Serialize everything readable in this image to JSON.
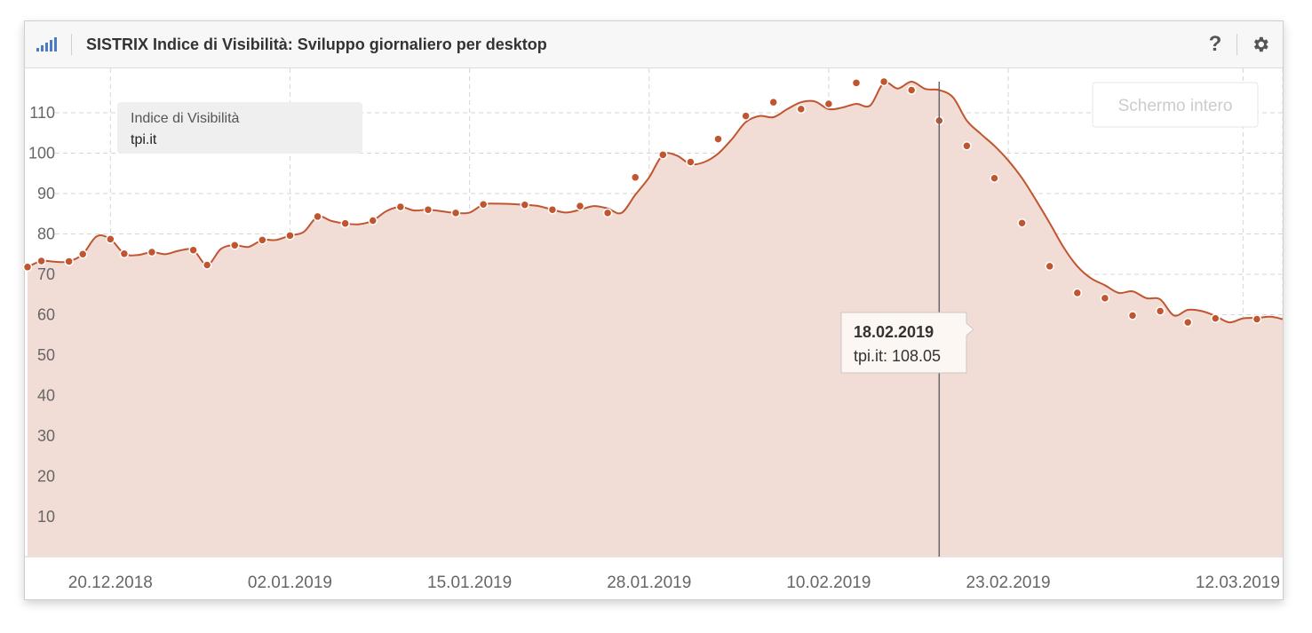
{
  "header": {
    "title": "SISTRIX Indice di Visibilità: Sviluppo giornaliero per desktop",
    "icon": "signal-bars-icon",
    "help_label": "?",
    "settings_icon": "gear-icon"
  },
  "fullscreen_button": {
    "label": "Schermo intero"
  },
  "legend": {
    "title": "Indice di Visibilità",
    "series": "tpi.it"
  },
  "tooltip": {
    "date": "18.02.2019",
    "text": "tpi.it: 108.05"
  },
  "colors": {
    "line": "#c0552f",
    "fill": "#f2ddd6",
    "marker": "#c0552f",
    "grid": "#d6d6d6",
    "crosshair": "#666666"
  },
  "chart_data": {
    "type": "area",
    "title": "SISTRIX Indice di Visibilità: Sviluppo giornaliero per desktop",
    "xlabel": "",
    "ylabel": "",
    "ylim": [
      0,
      120
    ],
    "yticks": [
      10,
      20,
      30,
      40,
      50,
      60,
      70,
      80,
      90,
      100,
      110
    ],
    "xticks": [
      "20.12.2018",
      "02.01.2019",
      "15.01.2019",
      "28.01.2019",
      "10.02.2019",
      "23.02.2019",
      "12.03.2019"
    ],
    "grid": true,
    "legend_position": "top-left",
    "series": [
      {
        "name": "tpi.it",
        "points": [
          [
            "14.12.2018",
            71.8
          ],
          [
            "15.12.2018",
            73.3
          ],
          [
            "16.12.2018",
            73.1
          ],
          [
            "17.12.2018",
            73.2
          ],
          [
            "18.12.2018",
            75.0
          ],
          [
            "19.12.2018",
            79.4
          ],
          [
            "20.12.2018",
            78.7
          ],
          [
            "21.12.2018",
            75.1
          ],
          [
            "22.12.2018",
            74.8
          ],
          [
            "23.12.2018",
            75.5
          ],
          [
            "24.12.2018",
            75.0
          ],
          [
            "25.12.2018",
            75.9
          ],
          [
            "26.12.2018",
            76.0
          ],
          [
            "27.12.2018",
            72.3
          ],
          [
            "28.12.2018",
            76.3
          ],
          [
            "29.12.2018",
            77.2
          ],
          [
            "30.12.2018",
            76.8
          ],
          [
            "31.12.2018",
            78.5
          ],
          [
            "01.01.2019",
            78.5
          ],
          [
            "02.01.2019",
            79.6
          ],
          [
            "03.01.2019",
            80.5
          ],
          [
            "04.01.2019",
            84.3
          ],
          [
            "05.01.2019",
            83.2
          ],
          [
            "06.01.2019",
            82.6
          ],
          [
            "07.01.2019",
            82.4
          ],
          [
            "08.01.2019",
            83.3
          ],
          [
            "09.01.2019",
            85.7
          ],
          [
            "10.01.2019",
            86.7
          ],
          [
            "11.01.2019",
            85.8
          ],
          [
            "12.01.2019",
            86.0
          ],
          [
            "13.01.2019",
            85.6
          ],
          [
            "14.01.2019",
            85.2
          ],
          [
            "15.01.2019",
            85.3
          ],
          [
            "16.01.2019",
            87.3
          ],
          [
            "17.01.2019",
            87.5
          ],
          [
            "18.01.2019",
            87.4
          ],
          [
            "19.01.2019",
            87.2
          ],
          [
            "20.01.2019",
            86.9
          ],
          [
            "21.01.2019",
            86.0
          ],
          [
            "22.01.2019",
            85.3
          ],
          [
            "23.01.2019",
            86.0
          ],
          [
            "24.01.2019",
            86.9
          ],
          [
            "25.01.2019",
            86.3
          ],
          [
            "26.01.2019",
            85.2
          ],
          [
            "27.01.2019",
            89.7
          ],
          [
            "28.01.2019",
            94.0
          ],
          [
            "29.01.2019",
            99.6
          ],
          [
            "30.01.2019",
            99.4
          ],
          [
            "31.01.2019",
            97.3
          ],
          [
            "01.02.2019",
            97.8
          ],
          [
            "02.02.2019",
            99.9
          ],
          [
            "03.02.2019",
            103.5
          ],
          [
            "04.02.2019",
            107.7
          ],
          [
            "05.02.2019",
            109.2
          ],
          [
            "06.02.2019",
            108.9
          ],
          [
            "07.02.2019",
            110.9
          ],
          [
            "08.02.2019",
            112.6
          ],
          [
            "09.02.2019",
            112.8
          ],
          [
            "10.02.2019",
            110.9
          ],
          [
            "11.02.2019",
            111.3
          ],
          [
            "12.02.2019",
            112.2
          ],
          [
            "13.02.2019",
            111.8
          ],
          [
            "14.02.2019",
            117.4
          ],
          [
            "15.02.2019",
            116.0
          ],
          [
            "16.02.2019",
            117.7
          ],
          [
            "17.02.2019",
            115.9
          ],
          [
            "18.02.2019",
            115.6
          ],
          [
            "19.02.2019",
            113.8
          ],
          [
            "20.02.2019",
            108.05
          ],
          [
            "21.02.2019",
            104.8
          ],
          [
            "22.02.2019",
            101.8
          ],
          [
            "23.02.2019",
            98.2
          ],
          [
            "24.02.2019",
            93.8
          ],
          [
            "25.02.2019",
            88.4
          ],
          [
            "26.02.2019",
            82.7
          ],
          [
            "27.02.2019",
            76.7
          ],
          [
            "28.02.2019",
            72.0
          ],
          [
            "01.03.2019",
            69.0
          ],
          [
            "02.03.2019",
            67.3
          ],
          [
            "03.03.2019",
            65.4
          ],
          [
            "04.03.2019",
            65.8
          ],
          [
            "05.03.2019",
            64.1
          ],
          [
            "06.03.2019",
            63.8
          ],
          [
            "07.03.2019",
            59.8
          ],
          [
            "08.03.2019",
            61.2
          ],
          [
            "09.03.2019",
            60.9
          ],
          [
            "10.03.2019",
            59.7
          ],
          [
            "11.03.2019",
            58.1
          ],
          [
            "12.03.2019",
            59.1
          ],
          [
            "13.03.2019",
            59.2
          ],
          [
            "14.03.2019",
            59.5
          ],
          [
            "15.03.2019",
            58.9
          ]
        ],
        "markers": [
          [
            "14.12.2018",
            71.8
          ],
          [
            "15.12.2018",
            73.3
          ],
          [
            "17.12.2018",
            73.2
          ],
          [
            "18.12.2018",
            75.0
          ],
          [
            "20.12.2018",
            78.7
          ],
          [
            "21.12.2018",
            75.1
          ],
          [
            "23.12.2018",
            75.5
          ],
          [
            "26.12.2018",
            76.0
          ],
          [
            "27.12.2018",
            72.3
          ],
          [
            "29.12.2018",
            77.2
          ],
          [
            "31.12.2018",
            78.5
          ],
          [
            "02.01.2019",
            79.6
          ],
          [
            "04.01.2019",
            84.3
          ],
          [
            "06.01.2019",
            82.6
          ],
          [
            "08.01.2019",
            83.3
          ],
          [
            "10.01.2019",
            86.7
          ],
          [
            "12.01.2019",
            86.0
          ],
          [
            "14.01.2019",
            85.2
          ],
          [
            "16.01.2019",
            87.3
          ],
          [
            "19.01.2019",
            87.2
          ],
          [
            "21.01.2019",
            86.0
          ],
          [
            "23.01.2019",
            86.9
          ],
          [
            "25.01.2019",
            85.2
          ],
          [
            "27.01.2019",
            94.0
          ],
          [
            "29.01.2019",
            99.6
          ],
          [
            "31.01.2019",
            97.8
          ],
          [
            "02.02.2019",
            103.5
          ],
          [
            "04.02.2019",
            109.2
          ],
          [
            "06.02.2019",
            112.6
          ],
          [
            "08.02.2019",
            110.9
          ],
          [
            "10.02.2019",
            112.2
          ],
          [
            "12.02.2019",
            117.4
          ],
          [
            "14.02.2019",
            117.7
          ],
          [
            "16.02.2019",
            115.6
          ],
          [
            "18.02.2019",
            108.05
          ],
          [
            "20.02.2019",
            101.8
          ],
          [
            "22.02.2019",
            93.8
          ],
          [
            "24.02.2019",
            82.7
          ],
          [
            "26.02.2019",
            72.0
          ],
          [
            "28.02.2019",
            65.4
          ],
          [
            "02.03.2019",
            64.1
          ],
          [
            "04.03.2019",
            59.8
          ],
          [
            "06.03.2019",
            60.9
          ],
          [
            "08.03.2019",
            58.1
          ],
          [
            "10.03.2019",
            59.1
          ],
          [
            "13.03.2019",
            58.9
          ]
        ]
      }
    ]
  }
}
